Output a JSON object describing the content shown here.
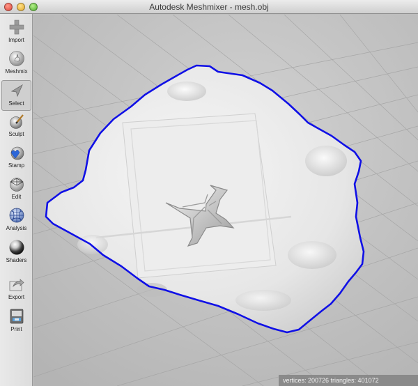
{
  "window": {
    "title": "Autodesk Meshmixer - mesh.obj"
  },
  "toolbar": {
    "items": [
      {
        "id": "import",
        "label": "Import",
        "icon": "plus-icon"
      },
      {
        "id": "meshmix",
        "label": "Meshmix",
        "icon": "bunny-icon"
      },
      {
        "id": "select",
        "label": "Select",
        "icon": "cursor-arrow-icon",
        "selected": true
      },
      {
        "id": "sculpt",
        "label": "Sculpt",
        "icon": "brush-icon"
      },
      {
        "id": "stamp",
        "label": "Stamp",
        "icon": "stamp-icon"
      },
      {
        "id": "edit",
        "label": "Edit",
        "icon": "wireframe-sphere-icon"
      },
      {
        "id": "analysis",
        "label": "Analysis",
        "icon": "analysis-sphere-icon"
      },
      {
        "id": "shaders",
        "label": "Shaders",
        "icon": "chrome-ball-icon"
      },
      {
        "id": "export",
        "label": "Export",
        "icon": "export-arrow-icon"
      },
      {
        "id": "print",
        "label": "Print",
        "icon": "printer-icon"
      }
    ]
  },
  "status": {
    "text": "vertices: 200726 triangles: 401072"
  },
  "colors": {
    "selection_boundary": "#1010e6",
    "viewport_bg": "#bdbdbd",
    "mesh": "#ececec"
  }
}
